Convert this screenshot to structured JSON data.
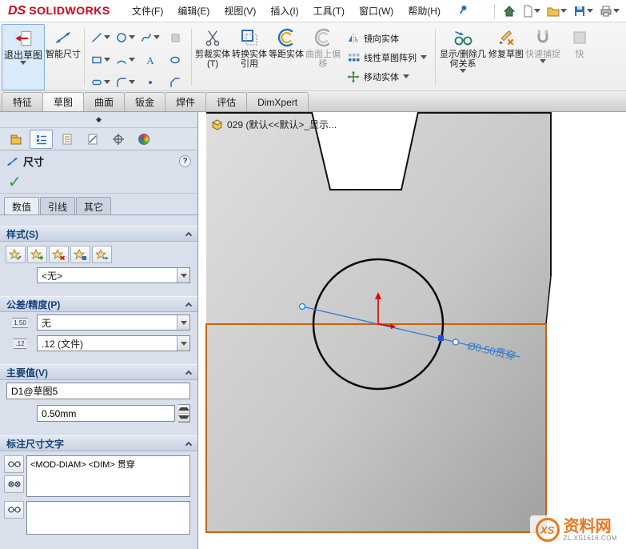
{
  "menubar": {
    "logo_mark": "DS",
    "logo_text": "SOLIDWORKS",
    "menus": [
      "文件(F)",
      "编辑(E)",
      "视图(V)",
      "插入(I)",
      "工具(T)",
      "窗口(W)",
      "帮助(H)"
    ],
    "quick_icons": [
      "home",
      "new-document",
      "open",
      "save",
      "print"
    ]
  },
  "ribbon": {
    "exit_sketch": "退出草图",
    "smart_dimension": "智能尺寸",
    "trim": "剪裁实体(T)",
    "convert": "转换实体引用",
    "offset": "等距实体",
    "surface_offset": "曲面上偏移",
    "mirror": "镜向实体",
    "linear_pattern": "线性草图阵列",
    "move": "移动实体",
    "display_delete": "显示/删除几何关系",
    "repair": "修复草图",
    "quick_snaps": "快速捕捉",
    "clipped": "快"
  },
  "tabs": {
    "items": [
      "特征",
      "草图",
      "曲面",
      "钣金",
      "焊件",
      "评估",
      "DimXpert"
    ],
    "active": "草图"
  },
  "panel": {
    "title": "尺寸",
    "value_tabs": [
      "数值",
      "引线",
      "其它"
    ],
    "style": {
      "header": "样式(S)",
      "selected": "<无>"
    },
    "tolerance": {
      "header": "公差/精度(P)",
      "type_icon": "1.50",
      "type_value": "无",
      "precision_icon": ".12",
      "precision_value": ".12 (文件)"
    },
    "primary": {
      "header": "主要值(V)",
      "name": "D1@草图5",
      "value": "0.50mm"
    },
    "dim_text": {
      "header": "标注尺寸文字",
      "value": "<MOD-DIAM> <DIM> 贯穿"
    }
  },
  "graphics": {
    "tree_label": "029 (默认<<默认>_显示...",
    "dimension_label": "Ø0.50贯穿"
  },
  "watermark": {
    "badge": "XS",
    "title": "资料网",
    "url": "ZL.XS1616.COM"
  },
  "colors": {
    "face_orange": "#c86400",
    "dimension_blue": "#2e7bd6",
    "origin_red": "#e00000",
    "logo_red": "#d6001c"
  }
}
